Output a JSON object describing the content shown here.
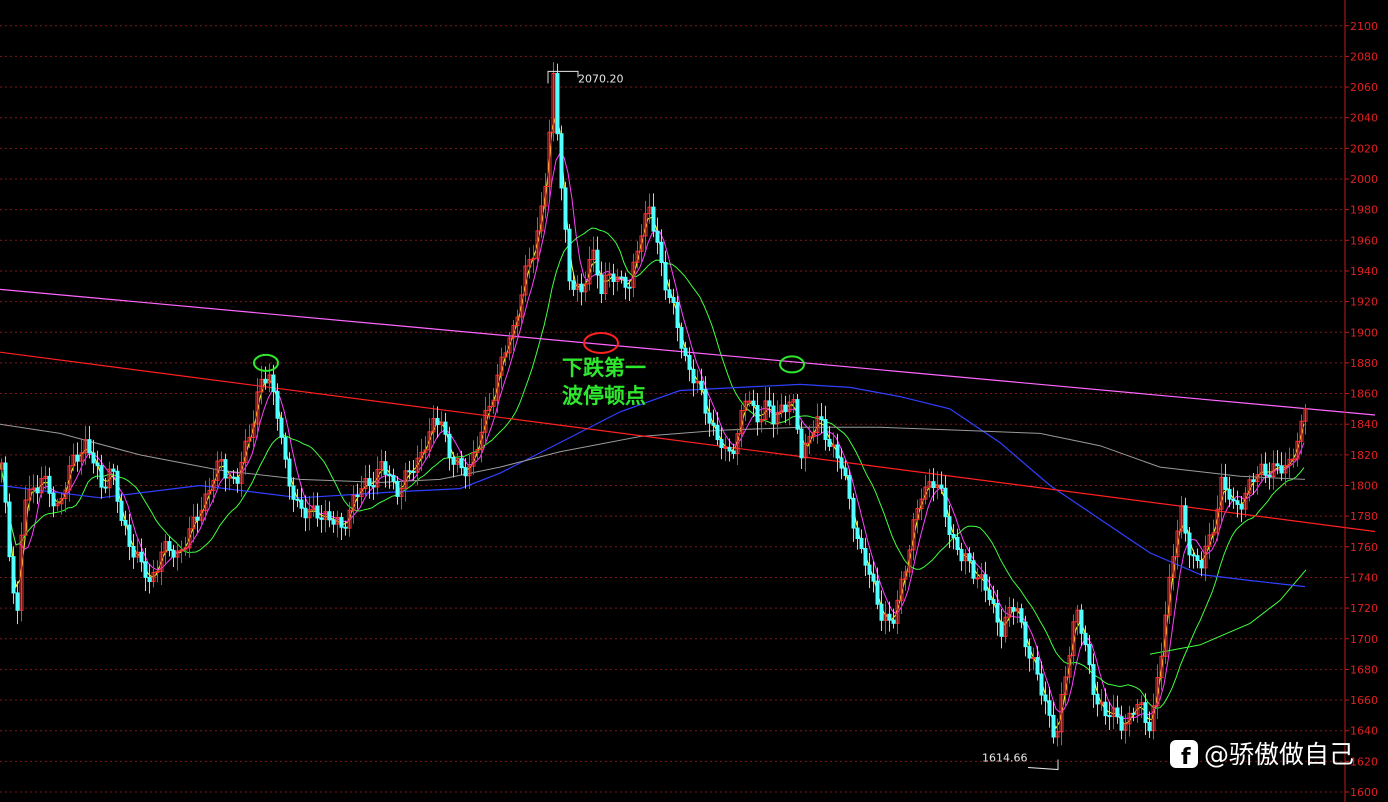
{
  "chart_data": {
    "type": "candlestick",
    "title": "",
    "xlabel": "",
    "ylabel": "",
    "ylim": [
      1600,
      2100
    ],
    "y_ticks": [
      1600,
      1620,
      1640,
      1660,
      1680,
      1700,
      1720,
      1740,
      1760,
      1780,
      1800,
      1820,
      1840,
      1860,
      1880,
      1900,
      1920,
      1940,
      1960,
      1980,
      2000,
      2020,
      2040,
      2060,
      2080,
      2100
    ],
    "grid": true,
    "colors": {
      "background": "#000000",
      "up_candle": "#ff3030",
      "down_candle": "#54ffff",
      "axis": "#c01a1a",
      "grid": "#7a1a1a",
      "ma5": "#e8e8e8",
      "ma10": "#ffff40",
      "ma20": "#ff40ff",
      "ma60": "#40ff40",
      "ma120": "#3040ff",
      "ma250": "#9a9a9a",
      "trend_upper": "#ff66ff",
      "trend_lower": "#ff2020",
      "annotation": "#2ee82e",
      "circle_green": "#2ee82e",
      "circle_red": "#ff2020"
    },
    "path_keyframes": [
      [
        0,
        1812
      ],
      [
        10,
        1745
      ],
      [
        16,
        1715
      ],
      [
        22,
        1790
      ],
      [
        40,
        1805
      ],
      [
        55,
        1785
      ],
      [
        70,
        1812
      ],
      [
        85,
        1830
      ],
      [
        100,
        1798
      ],
      [
        110,
        1815
      ],
      [
        120,
        1775
      ],
      [
        135,
        1755
      ],
      [
        148,
        1735
      ],
      [
        160,
        1758
      ],
      [
        175,
        1755
      ],
      [
        190,
        1770
      ],
      [
        205,
        1795
      ],
      [
        220,
        1815
      ],
      [
        235,
        1800
      ],
      [
        250,
        1840
      ],
      [
        258,
        1865
      ],
      [
        268,
        1870
      ],
      [
        278,
        1845
      ],
      [
        286,
        1800
      ],
      [
        295,
        1790
      ],
      [
        310,
        1780
      ],
      [
        325,
        1782
      ],
      [
        340,
        1770
      ],
      [
        350,
        1790
      ],
      [
        365,
        1800
      ],
      [
        380,
        1812
      ],
      [
        395,
        1798
      ],
      [
        410,
        1808
      ],
      [
        425,
        1830
      ],
      [
        440,
        1845
      ],
      [
        448,
        1820
      ],
      [
        460,
        1808
      ],
      [
        475,
        1822
      ],
      [
        490,
        1858
      ],
      [
        500,
        1880
      ],
      [
        512,
        1902
      ],
      [
        522,
        1935
      ],
      [
        533,
        1952
      ],
      [
        545,
        2005
      ],
      [
        552,
        2062
      ],
      [
        560,
        1998
      ],
      [
        568,
        1935
      ],
      [
        580,
        1922
      ],
      [
        590,
        1958
      ],
      [
        600,
        1925
      ],
      [
        610,
        1942
      ],
      [
        620,
        1932
      ],
      [
        628,
        1928
      ],
      [
        638,
        1965
      ],
      [
        648,
        1978
      ],
      [
        656,
        1958
      ],
      [
        665,
        1930
      ],
      [
        675,
        1905
      ],
      [
        685,
        1882
      ],
      [
        695,
        1865
      ],
      [
        705,
        1850
      ],
      [
        715,
        1832
      ],
      [
        725,
        1818
      ],
      [
        735,
        1832
      ],
      [
        745,
        1858
      ],
      [
        755,
        1845
      ],
      [
        765,
        1852
      ],
      [
        772,
        1842
      ],
      [
        780,
        1852
      ],
      [
        790,
        1856
      ],
      [
        800,
        1822
      ],
      [
        815,
        1842
      ],
      [
        830,
        1828
      ],
      [
        840,
        1812
      ],
      [
        850,
        1785
      ],
      [
        860,
        1755
      ],
      [
        870,
        1738
      ],
      [
        880,
        1718
      ],
      [
        890,
        1705
      ],
      [
        900,
        1738
      ],
      [
        910,
        1765
      ],
      [
        920,
        1795
      ],
      [
        930,
        1805
      ],
      [
        940,
        1792
      ],
      [
        950,
        1768
      ],
      [
        960,
        1752
      ],
      [
        970,
        1748
      ],
      [
        980,
        1738
      ],
      [
        990,
        1722
      ],
      [
        1000,
        1708
      ],
      [
        1015,
        1722
      ],
      [
        1030,
        1685
      ],
      [
        1045,
        1658
      ],
      [
        1055,
        1632
      ],
      [
        1065,
        1682
      ],
      [
        1075,
        1722
      ],
      [
        1085,
        1688
      ],
      [
        1095,
        1662
      ],
      [
        1105,
        1648
      ],
      [
        1115,
        1652
      ],
      [
        1125,
        1642
      ],
      [
        1138,
        1660
      ],
      [
        1150,
        1640
      ],
      [
        1160,
        1692
      ],
      [
        1170,
        1752
      ],
      [
        1180,
        1780
      ],
      [
        1190,
        1755
      ],
      [
        1200,
        1748
      ],
      [
        1210,
        1768
      ],
      [
        1220,
        1802
      ],
      [
        1232,
        1786
      ],
      [
        1245,
        1795
      ],
      [
        1260,
        1812
      ],
      [
        1275,
        1808
      ],
      [
        1290,
        1818
      ],
      [
        1300,
        1835
      ],
      [
        1306,
        1858
      ]
    ],
    "moving_averages": [
      {
        "key": "ma10",
        "window": 3,
        "color": "#ffff40"
      },
      {
        "key": "ma20",
        "window": 6,
        "color": "#ff40ff"
      },
      {
        "key": "ma60",
        "window": 18,
        "color": "#40ff40"
      }
    ],
    "ma120_points": [
      [
        0,
        1800
      ],
      [
        100,
        1792
      ],
      [
        200,
        1800
      ],
      [
        300,
        1792
      ],
      [
        400,
        1796
      ],
      [
        460,
        1798
      ],
      [
        500,
        1808
      ],
      [
        560,
        1828
      ],
      [
        620,
        1848
      ],
      [
        680,
        1862
      ],
      [
        740,
        1864
      ],
      [
        800,
        1866
      ],
      [
        850,
        1864
      ],
      [
        900,
        1858
      ],
      [
        950,
        1850
      ],
      [
        1000,
        1828
      ],
      [
        1050,
        1800
      ],
      [
        1100,
        1778
      ],
      [
        1150,
        1756
      ],
      [
        1200,
        1742
      ],
      [
        1250,
        1738
      ],
      [
        1305,
        1734
      ]
    ],
    "ma250_points": [
      [
        0,
        1840
      ],
      [
        60,
        1834
      ],
      [
        140,
        1820
      ],
      [
        220,
        1810
      ],
      [
        300,
        1804
      ],
      [
        380,
        1802
      ],
      [
        440,
        1804
      ],
      [
        500,
        1812
      ],
      [
        560,
        1822
      ],
      [
        640,
        1832
      ],
      [
        720,
        1836
      ],
      [
        800,
        1838
      ],
      [
        880,
        1838
      ],
      [
        960,
        1836
      ],
      [
        1040,
        1834
      ],
      [
        1100,
        1826
      ],
      [
        1160,
        1812
      ],
      [
        1240,
        1806
      ],
      [
        1305,
        1804
      ]
    ],
    "ma60_tail": [
      [
        1150,
        1690
      ],
      [
        1200,
        1696
      ],
      [
        1250,
        1710
      ],
      [
        1280,
        1725
      ],
      [
        1306,
        1745
      ]
    ],
    "trendlines": [
      {
        "name": "upper",
        "from": [
          0,
          1928
        ],
        "to": [
          1375,
          1846
        ]
      },
      {
        "name": "lower",
        "from": [
          0,
          1887
        ],
        "to": [
          1375,
          1770
        ]
      }
    ],
    "high_label": {
      "text": "2070.20",
      "value": 2070.2,
      "x": 548
    },
    "low_label": {
      "text": "1614.66",
      "value": 1614.66,
      "x": 1058
    },
    "annotations": [
      {
        "line1": "下跌第一",
        "line2": "波停顿点",
        "value": 1872,
        "x": 604
      }
    ],
    "markers": [
      {
        "kind": "green-circle",
        "x": 266,
        "value": 1880
      },
      {
        "kind": "green-circle",
        "x": 792,
        "value": 1879
      },
      {
        "kind": "red-circle",
        "x": 601,
        "value": 1893
      }
    ]
  },
  "watermark": {
    "icon": "facebook-icon",
    "text": "@骄傲做自己"
  }
}
